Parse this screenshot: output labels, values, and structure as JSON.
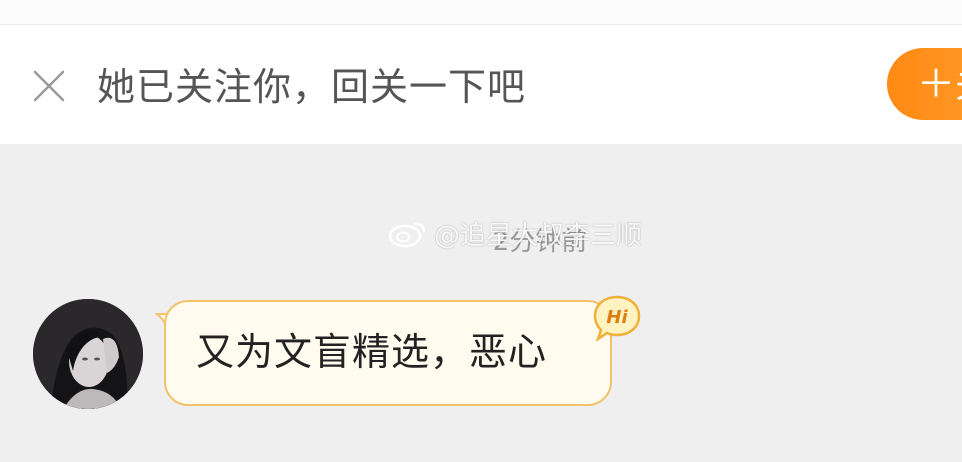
{
  "follow_bar": {
    "message": "她已关注你，回关一下吧",
    "follow_button_label": "＋关注"
  },
  "chat": {
    "timestamp": "2分钟前",
    "watermark": "@追星大叔李三顺",
    "message": {
      "text": "又为文盲精选，恶心",
      "badge": "Hi"
    }
  },
  "colors": {
    "accent": "#ff8a14",
    "bubble_bg": "#fffbef",
    "bubble_border": "#f2c36b",
    "chat_bg": "#efefef"
  },
  "icons": [
    "close-icon",
    "weibo-logo-icon",
    "hi-badge-icon"
  ]
}
